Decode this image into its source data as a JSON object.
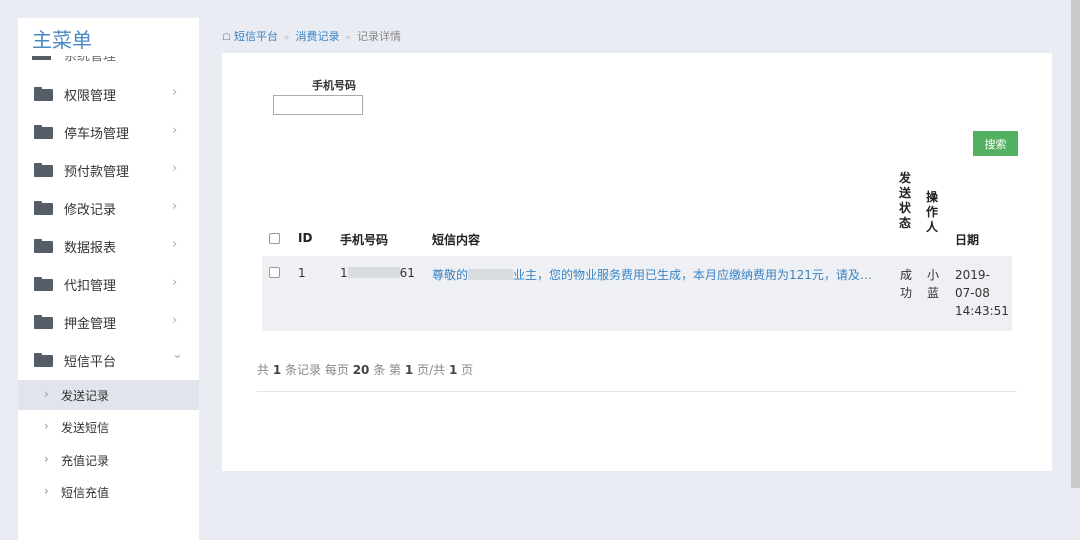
{
  "sidebar": {
    "title": "主菜单",
    "peek_label": "系统管理",
    "items": [
      {
        "label": "权限管理"
      },
      {
        "label": "停车场管理"
      },
      {
        "label": "预付款管理"
      },
      {
        "label": "修改记录"
      },
      {
        "label": "数据报表"
      },
      {
        "label": "代扣管理"
      },
      {
        "label": "押金管理"
      },
      {
        "label": "短信平台"
      }
    ],
    "subitems": [
      {
        "label": "发送记录"
      },
      {
        "label": "发送短信"
      },
      {
        "label": "充值记录"
      },
      {
        "label": "短信充值"
      }
    ],
    "folder_icon": "folder-icon",
    "chevron_right": "›",
    "chevron_down": "⌄",
    "sub_arrow": "›"
  },
  "breadcrumb": {
    "home_icon": "home-icon",
    "items": [
      "短信平台",
      "消费记录",
      "记录详情"
    ],
    "separator": "»"
  },
  "filter": {
    "phone_label": "手机号码",
    "phone_value": "",
    "search_label": "搜索"
  },
  "table": {
    "headers": {
      "id": "ID",
      "phone": "手机号码",
      "content": "短信内容",
      "status": [
        "发",
        "送",
        "状",
        "态"
      ],
      "operator": [
        "操",
        "作",
        "人"
      ],
      "date": "日期"
    },
    "rows": [
      {
        "id": "1",
        "phone_prefix": "1",
        "phone_suffix": "61",
        "content_prefix": "尊敬的",
        "content_suffix": "业主，您的物业服务费用已生成，本月应缴纳费用为121元，请及…",
        "status": [
          "成",
          "功"
        ],
        "operator": [
          "小",
          "蓝"
        ],
        "date": [
          "2019-",
          "07-08",
          "14:43:51"
        ]
      }
    ]
  },
  "pager": {
    "p1": "共",
    "total": "1",
    "p2": "条记录 每页",
    "page_size": "20",
    "p3": "条 第",
    "page": "1",
    "p4": "页/共",
    "pages": "1",
    "p5": "页"
  },
  "colors": {
    "accent": "#4a88c6",
    "link": "#3a84c4",
    "search_button": "#53b060",
    "background": "#e9ecf3"
  }
}
